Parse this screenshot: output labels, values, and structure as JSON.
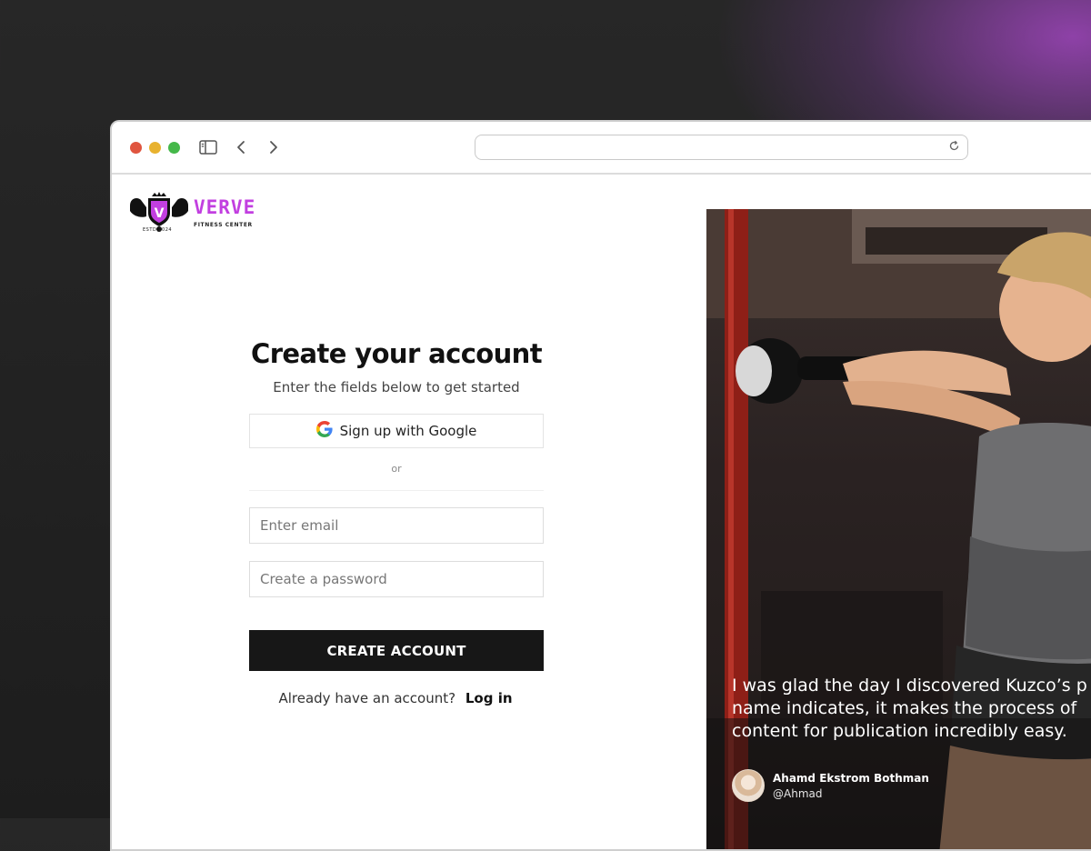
{
  "colors": {
    "brand": "#c23fe0",
    "primary_button": "#171717",
    "traffic_red": "#e0553f",
    "traffic_yellow": "#e8b22f",
    "traffic_green": "#45b84a"
  },
  "browser": {
    "icons": [
      "sidebar-icon",
      "back-icon",
      "forward-icon",
      "reload-icon"
    ],
    "address": ""
  },
  "logo": {
    "emblem_letter": "V",
    "name": "VERVE",
    "tagline": "FITNESS CENTER",
    "estd": "ESTD 2024"
  },
  "form": {
    "title": "Create your account",
    "subtitle": "Enter the fields below to get started",
    "google_label": "Sign up with Google",
    "or_label": "or",
    "email_placeholder": "Enter email",
    "password_placeholder": "Create a password",
    "submit_label": "CREATE ACCOUNT",
    "login_prompt": "Already have an account?",
    "login_link": "Log in"
  },
  "testimonial": {
    "quote_line1": "I was glad the day I discovered Kuzco’s p",
    "quote_line2": "name indicates, it makes the process of",
    "quote_line3": "content for publication incredibly easy.",
    "author_name": "Ahamd Ekstrom Bothman",
    "author_handle": "@Ahmad"
  }
}
